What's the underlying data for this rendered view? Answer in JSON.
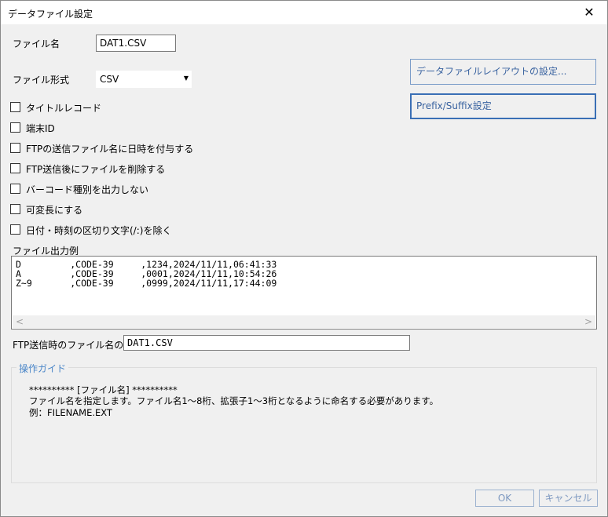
{
  "window": {
    "title": "データファイル設定",
    "close_glyph": "✕"
  },
  "file_name": {
    "label": "ファイル名",
    "value": "DAT1.CSV"
  },
  "file_format": {
    "label": "ファイル形式",
    "value": "CSV"
  },
  "right_buttons": {
    "layout": "データファイルレイアウトの設定...",
    "prefix_suffix": "Prefix/Suffix設定"
  },
  "checkboxes": [
    {
      "label": "タイトルレコード",
      "checked": false
    },
    {
      "label": "端末ID",
      "checked": false
    },
    {
      "label": "FTPの送信ファイル名に日時を付与する",
      "checked": false
    },
    {
      "label": "FTP送信後にファイルを削除する",
      "checked": false
    },
    {
      "label": "バーコード種別を出力しない",
      "checked": false
    },
    {
      "label": "可変長にする",
      "checked": false
    },
    {
      "label": "日付・時刻の区切り文字(/:)を除く",
      "checked": false
    }
  ],
  "output_example": {
    "label": "ファイル出力例",
    "lines": [
      "D         ,CODE-39     ,1234,2024/11/11,06:41:33",
      "A         ,CODE-39     ,0001,2024/11/11,10:54:26",
      "Z~9       ,CODE-39     ,0999,2024/11/11,17:44:09"
    ],
    "scroll_left": "<",
    "scroll_right": ">"
  },
  "ftp_example": {
    "label": "FTP送信時のファイル名の例",
    "value": "DAT1.CSV"
  },
  "guide": {
    "title": "操作ガイド",
    "lines": [
      "********** [ファイル名] **********",
      "ファイル名を指定します。ファイル名1～8桁、拡張子1～3桁となるように命名する必要があります。",
      "例：FILENAME.EXT"
    ]
  },
  "footer": {
    "ok": "OK",
    "cancel": "キャンセル"
  }
}
